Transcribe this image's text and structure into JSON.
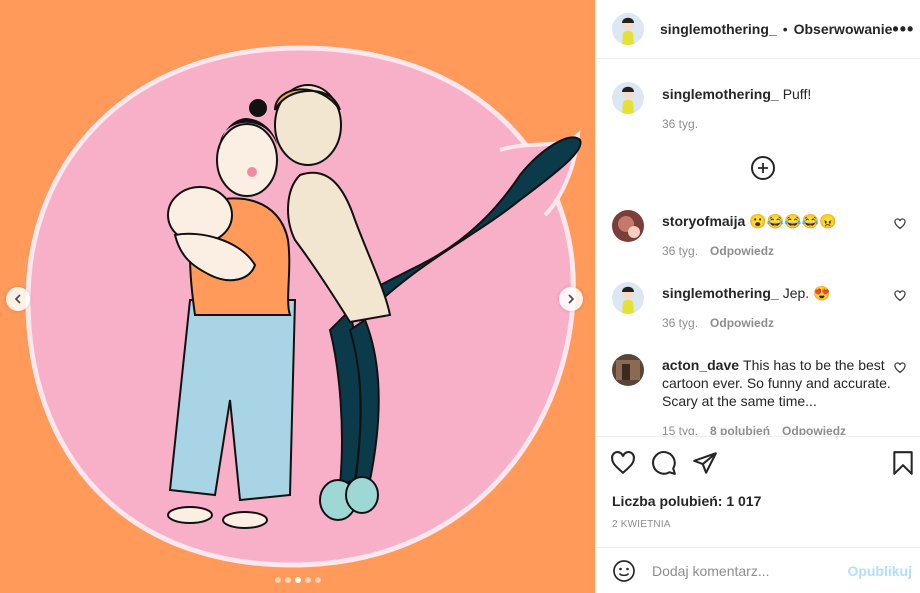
{
  "post": {
    "username": "singlemothering_",
    "separator": "•",
    "follow_label": "Obserwowanie",
    "more_icon": "more-icon"
  },
  "caption": {
    "username": "singlemothering_",
    "text": "Puff!",
    "time": "36 tyg."
  },
  "comments": [
    {
      "username": "storyofmaija",
      "text": "😮😂😂😂😠",
      "time": "36 tyg.",
      "reply_label": "Odpowiedz"
    },
    {
      "username": "singlemothering_",
      "text": "Jep. 😍",
      "time": "36 tyg.",
      "reply_label": "Odpowiedz"
    },
    {
      "username": "acton_dave",
      "text": "This has to be the best cartoon ever. So funny and accurate. Scary at the same time...",
      "time": "15 tyg.",
      "likes": "8 polubień",
      "reply_label": "Odpowiedz"
    }
  ],
  "likes_label": "Liczba polubień: 1 017",
  "date_label": "2 KWIETNIA",
  "composer": {
    "placeholder": "Dodaj komentarz...",
    "publish_label": "Opublikuj"
  },
  "colors": {
    "background": "#ff9a5a",
    "bubble": "#f8b0c9",
    "publish": "#b2dffc"
  },
  "carousel": {
    "count": 5,
    "active": 3
  }
}
